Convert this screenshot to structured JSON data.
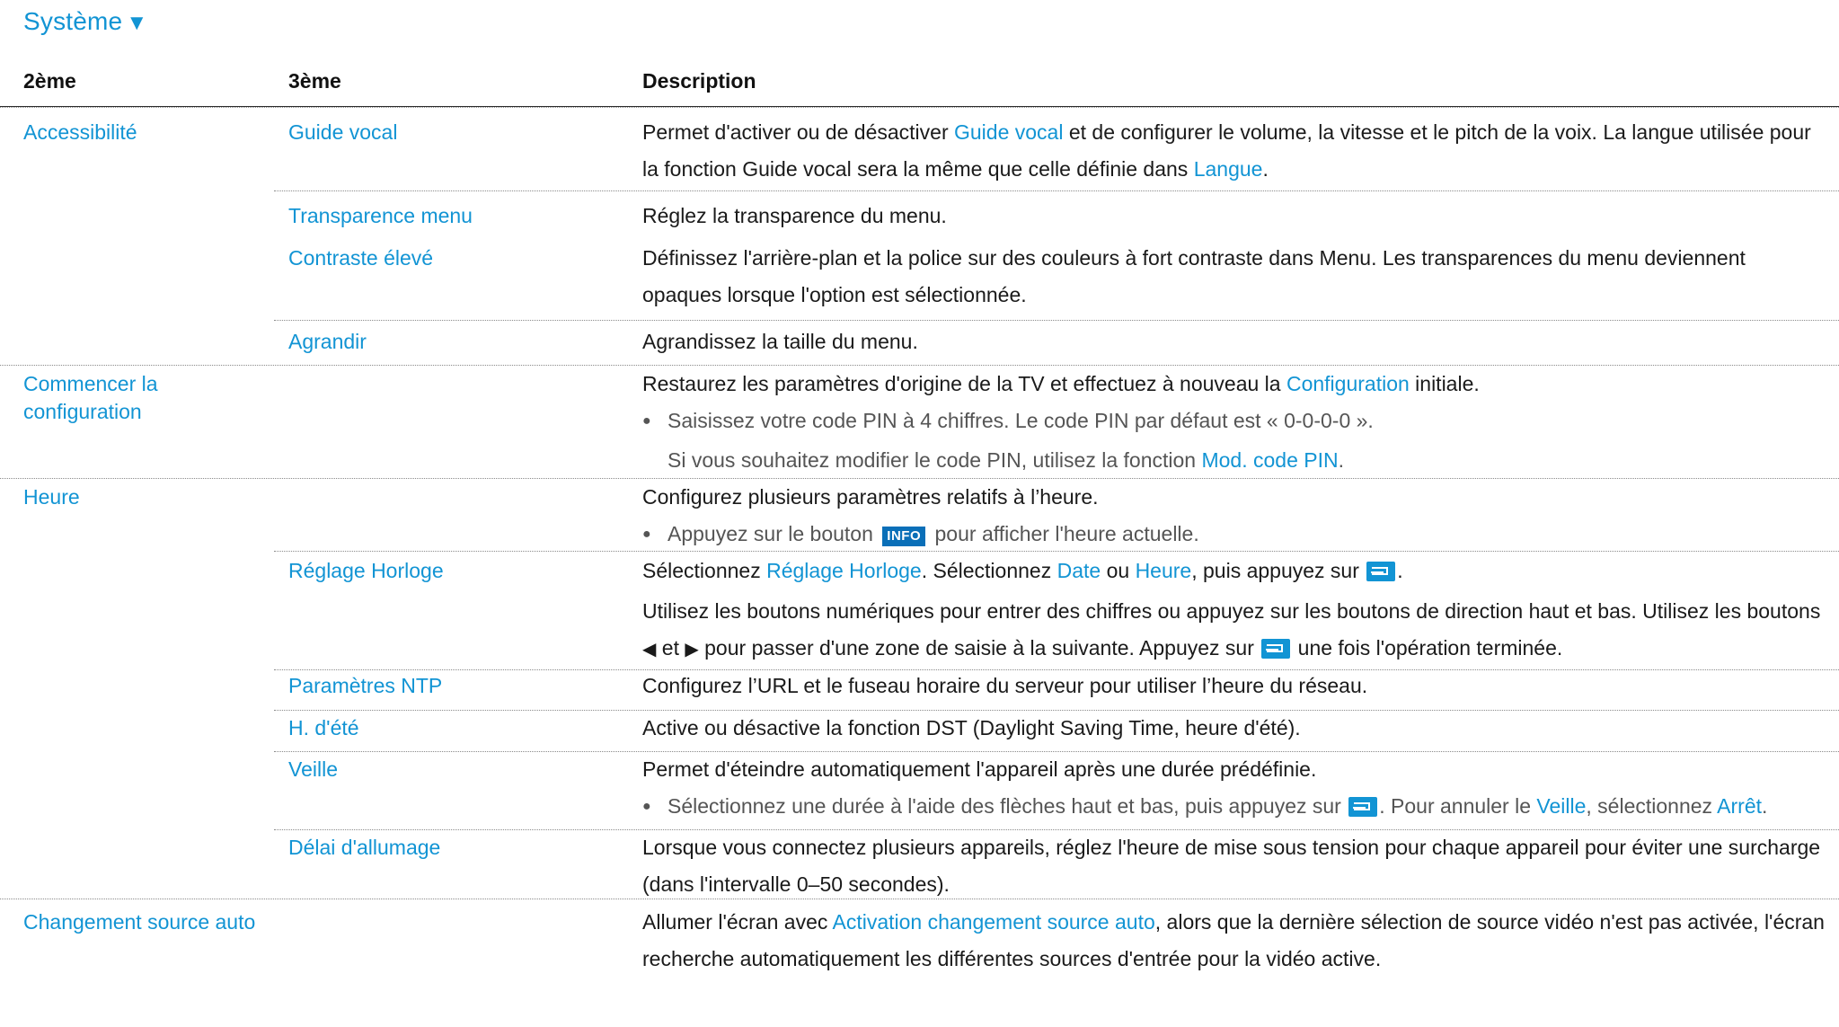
{
  "title": "Système",
  "headers": {
    "col1": "2ème",
    "col2": "3ème",
    "col3": "Description"
  },
  "rows": {
    "accessibilite": {
      "label": "Accessibilité",
      "guide_vocal": {
        "label": "Guide vocal",
        "d1": "Permet d'activer ou de désactiver ",
        "d2": "Guide vocal",
        "d3": " et de configurer le volume, la vitesse et le pitch de la voix. La langue utilisée pour",
        "d4": "la fonction Guide vocal sera la même que celle définie dans ",
        "d5": "Langue",
        "d6": "."
      },
      "transparence": {
        "label": "Transparence menu",
        "desc": "Réglez la transparence du menu."
      },
      "contraste": {
        "label": "Contraste élevé",
        "d1": "Définissez l'arrière-plan et la police sur des couleurs à fort contraste dans Menu. Les transparences du menu deviennent",
        "d2": "opaques lorsque l'option est sélectionnée."
      },
      "agrandir": {
        "label": "Agrandir",
        "desc": "Agrandissez la taille du menu."
      }
    },
    "commencer": {
      "label": "Commencer la configuration",
      "d1": "Restaurez les paramètres d'origine de la TV et effectuez à nouveau la ",
      "d2": "Configuration",
      "d3": " initiale.",
      "n1": "Saisissez votre code PIN à 4 chiffres. Le code PIN par défaut est « 0-0-0-0 ».",
      "n2": "Si vous souhaitez modifier le code PIN, utilisez la fonction ",
      "n3": "Mod. code PIN",
      "n4": "."
    },
    "heure": {
      "label": "Heure",
      "d1": "Configurez plusieurs paramètres relatifs à l’heure.",
      "n1": "Appuyez sur le bouton ",
      "n_badge": "INFO",
      "n2": " pour afficher l'heure actuelle.",
      "reglage": {
        "label": "Réglage Horloge",
        "a1": "Sélectionnez ",
        "a2": "Réglage Horloge",
        "a3": ". Sélectionnez ",
        "a4": "Date",
        "a5": " ou ",
        "a6": "Heure",
        "a7": ", puis appuyez sur ",
        "a8": ".",
        "b1": "Utilisez les boutons numériques pour entrer des chiffres ou appuyez sur les boutons de direction haut et bas. Utilisez les boutons",
        "c1": " et ",
        "c2": " pour passer d'une zone de saisie à la suivante. Appuyez sur ",
        "c3": " une fois l'opération terminée."
      },
      "ntp": {
        "label": "Paramètres NTP",
        "desc": "Configurez l’URL et le fuseau horaire du serveur pour utiliser l’heure du réseau."
      },
      "ete": {
        "label": "H. d'été",
        "desc": "Active ou désactive la fonction DST (Daylight Saving Time, heure d'été)."
      },
      "veille": {
        "label": "Veille",
        "desc": "Permet d'éteindre automatiquement l'appareil après une durée prédéfinie.",
        "n1": "Sélectionnez une durée à l'aide des flèches haut et bas, puis appuyez sur ",
        "n2": ". Pour annuler le ",
        "n3": "Veille",
        "n4": ", sélectionnez ",
        "n5": "Arrêt",
        "n6": "."
      },
      "delai": {
        "label": "Délai d'allumage",
        "d1": "Lorsque vous connectez plusieurs appareils, réglez l'heure de mise sous tension pour chaque appareil pour éviter une surcharge",
        "d2": "(dans l'intervalle 0–50 secondes)."
      }
    },
    "changement": {
      "label": "Changement source auto",
      "d1": "Allumer l'écran avec ",
      "d2": "Activation changement source auto",
      "d3": ", alors que la dernière sélection de source vidéo n'est pas activée, l'écran",
      "d4": "recherche automatiquement les différentes sources d'entrée pour la vidéo active."
    }
  }
}
